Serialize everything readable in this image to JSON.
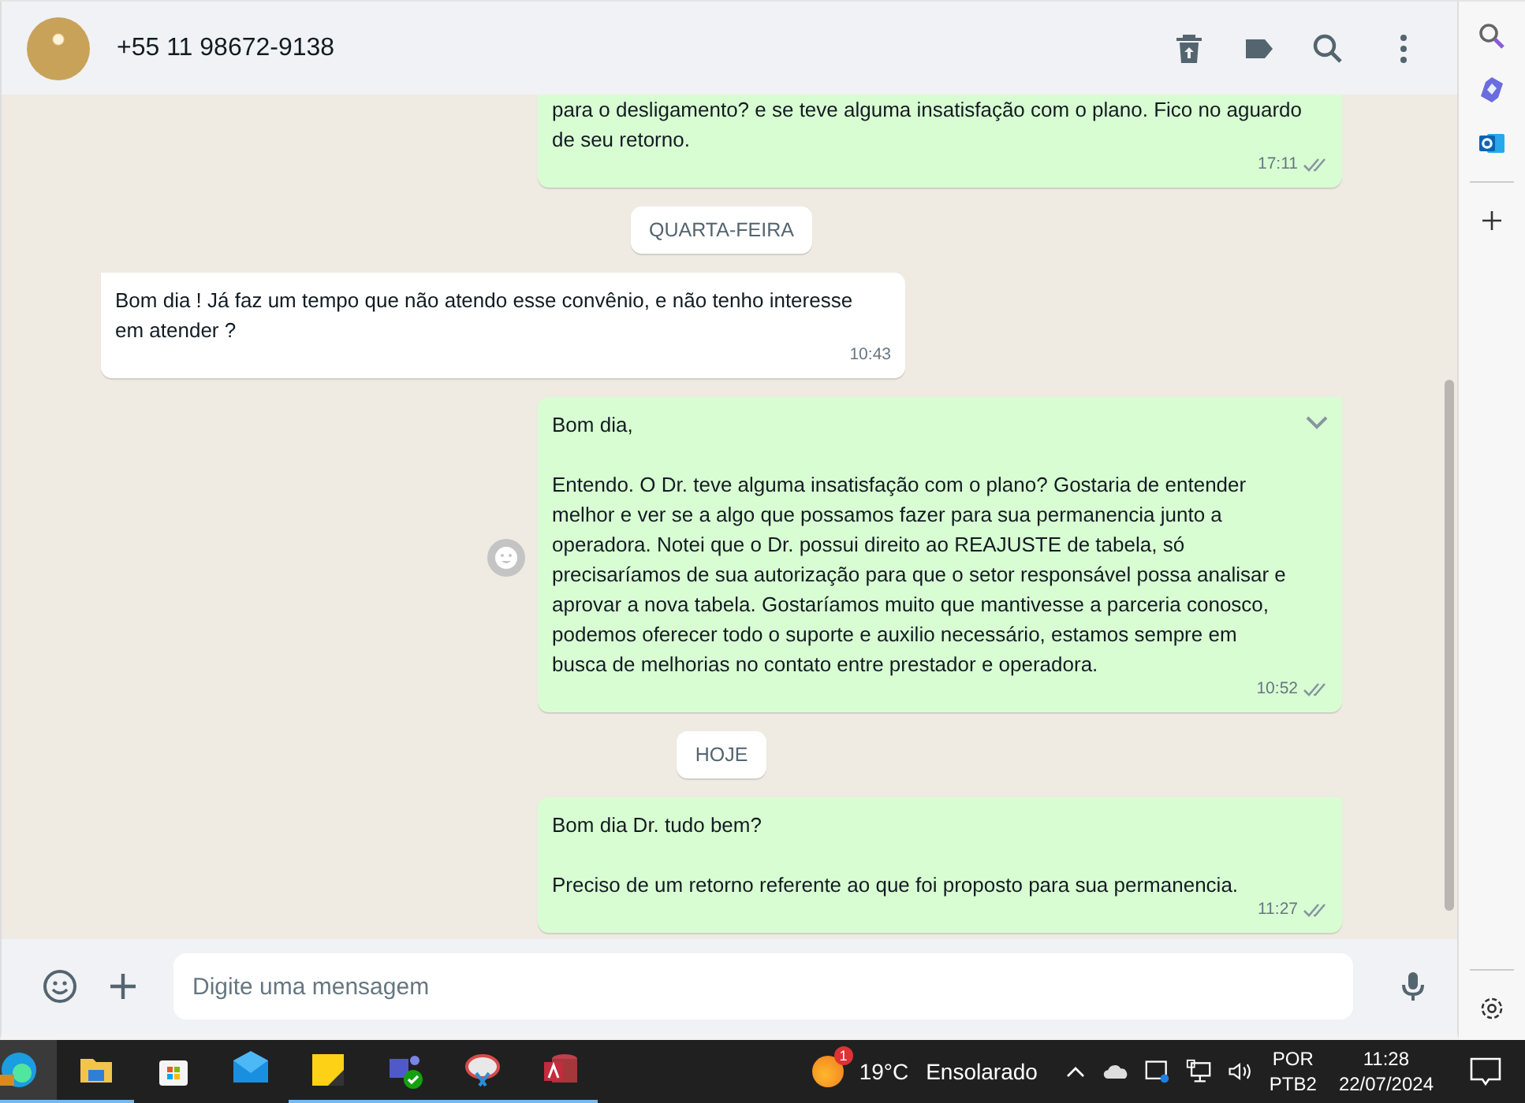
{
  "header": {
    "contact": "+55 11 98672-9138"
  },
  "messages": [
    {
      "kind": "out",
      "cut": true,
      "text": "para o desligamento? e se teve alguma insatisfação com o plano. Fico no aguardo de seu retorno.",
      "time": "17:11",
      "hovered": false
    },
    {
      "kind": "date",
      "text": "QUARTA-FEIRA"
    },
    {
      "kind": "in",
      "cut": false,
      "text": "Bom dia ! Já faz um tempo que não atendo esse convênio, e não tenho interesse em atender ?",
      "time": "10:43",
      "hovered": false
    },
    {
      "kind": "out",
      "cut": false,
      "text": "Bom dia,\n\nEntendo. O Dr. teve alguma insatisfação com o plano? Gostaria de entender melhor e ver se a algo que possamos fazer para sua permanencia junto a operadora. Notei que o Dr. possui direito ao REAJUSTE de tabela, só precisaríamos de sua autorização para que o setor responsável possa analisar e aprovar a nova tabela. Gostaríamos muito que mantivesse a parceria conosco, podemos oferecer todo o suporte e auxilio necessário, estamos sempre em busca de melhorias no contato entre prestador e operadora.",
      "time": "10:52",
      "hovered": true
    },
    {
      "kind": "date",
      "text": "HOJE"
    },
    {
      "kind": "out",
      "cut": false,
      "text": "Bom dia Dr. tudo bem?\n\nPreciso de um retorno referente ao que foi proposto para sua permanencia.",
      "time": "11:27",
      "hovered": false
    }
  ],
  "composer": {
    "placeholder": "Digite uma mensagem"
  },
  "taskbar": {
    "apps": [
      {
        "kind": "edge",
        "running": true,
        "selected": true
      },
      {
        "kind": "folder",
        "running": true,
        "selected": false
      },
      {
        "kind": "store",
        "running": false,
        "selected": false
      },
      {
        "kind": "mail",
        "running": false,
        "selected": false
      },
      {
        "kind": "note",
        "running": true,
        "selected": false
      },
      {
        "kind": "teams",
        "running": true,
        "selected": false
      },
      {
        "kind": "snip",
        "running": true,
        "selected": false
      },
      {
        "kind": "access",
        "running": true,
        "selected": false
      }
    ],
    "weather": {
      "badge": "1",
      "temperature": "19°C",
      "condition": "Ensolarado"
    },
    "language": {
      "code": "POR",
      "layout": "PTB2"
    },
    "clock": {
      "time": "11:28",
      "date": "22/07/2024"
    }
  }
}
